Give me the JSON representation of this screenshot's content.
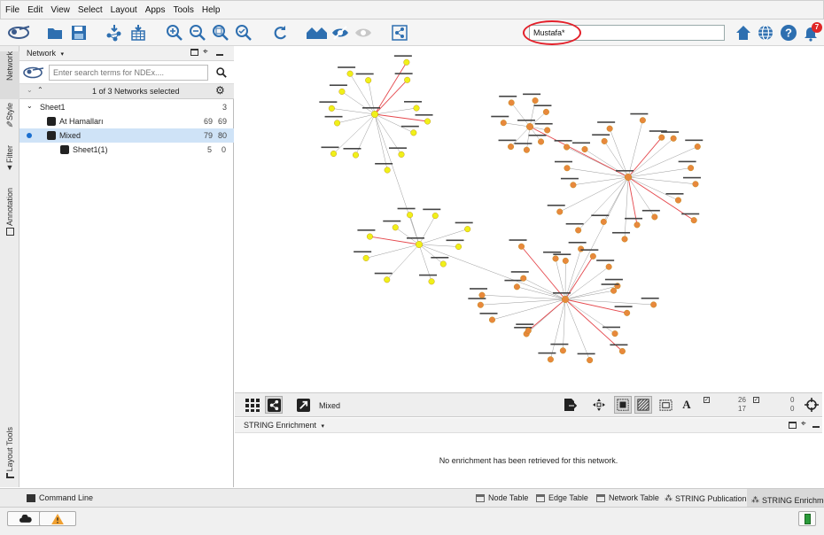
{
  "menu": [
    "File",
    "Edit",
    "View",
    "Select",
    "Layout",
    "Apps",
    "Tools",
    "Help"
  ],
  "search": {
    "value": "Mustafa*"
  },
  "notifications": {
    "count": "7"
  },
  "left_tabs": [
    "Network",
    "Style",
    "Filter",
    "Annotation",
    "Layout Tools"
  ],
  "network_panel": {
    "title": "Network",
    "ndex_placeholder": "Enter search terms for NDEx....",
    "selection_status": "1 of 3 Networks selected",
    "collection": {
      "name": "Sheet1",
      "count": "3"
    },
    "networks": [
      {
        "name": "At Hamalları",
        "nodes": "69",
        "edges": "69",
        "selected": false
      },
      {
        "name": "Mixed",
        "nodes": "79",
        "edges": "80",
        "selected": true
      },
      {
        "name": "Sheet1(1)",
        "nodes": "5",
        "edges": "0",
        "selected": false
      }
    ]
  },
  "canvas": {
    "network_name": "Mixed"
  },
  "canvas_stats": {
    "nodes_selected": "26",
    "nodes_total": "17",
    "edges_selected": "0",
    "edges_total": "0"
  },
  "enrichment": {
    "title": "STRING Enrichment",
    "message": "No enrichment has been retrieved for this network."
  },
  "bottom_tabs": {
    "command_line": "Command Line",
    "node_table": "Node Table",
    "edge_table": "Edge Table",
    "network_table": "Network Table",
    "string_publications": "STRING Publications",
    "string_enrichment": "STRING Enrichmen"
  },
  "colors": {
    "accent_ring": "#e3202a",
    "node_yellow": "#f0f019",
    "node_orange": "#e8883c",
    "edge_red": "#e5484d",
    "edge_gray": "#9a9a9a"
  }
}
